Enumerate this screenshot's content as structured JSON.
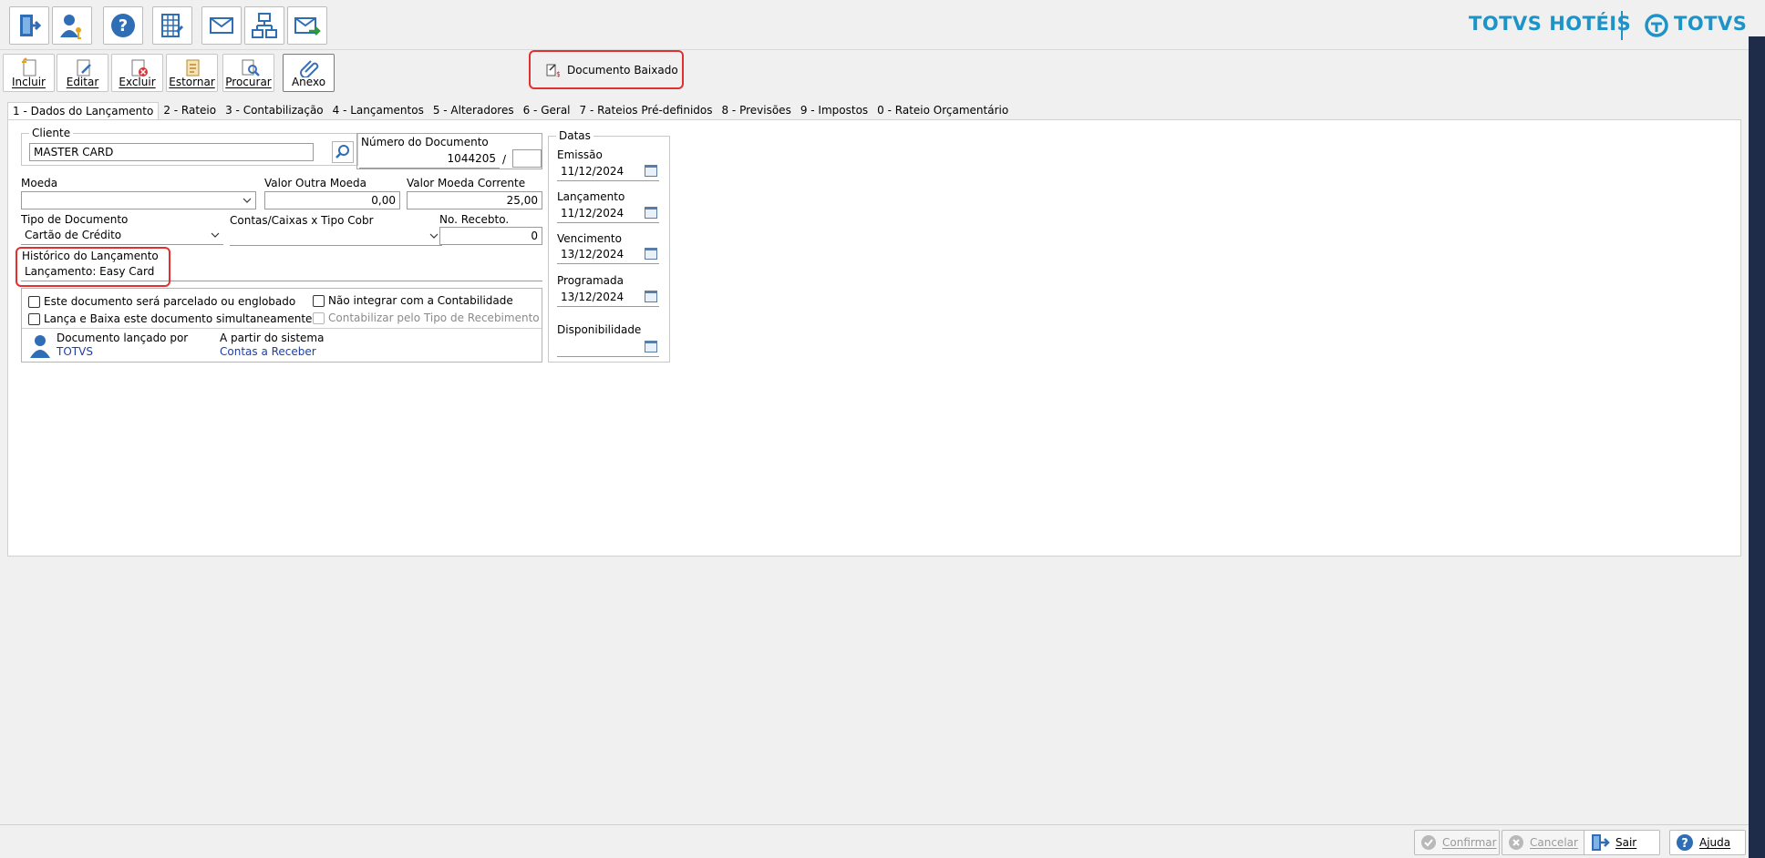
{
  "brand": {
    "product": "TOTVS HOTÉIS",
    "company": "TOTVS",
    "color": "#1e93c8"
  },
  "top_toolbar": [
    {
      "name": "exit-door-icon"
    },
    {
      "name": "user-key-icon"
    },
    {
      "name": "help-icon"
    },
    {
      "name": "calculator-grid-icon"
    },
    {
      "name": "mail-icon"
    },
    {
      "name": "hierarchy-icon"
    },
    {
      "name": "mail-send-icon"
    }
  ],
  "actions": {
    "incluir": "Incluir",
    "editar": "Editar",
    "excluir": "Excluir",
    "estornar": "Estornar",
    "procurar": "Procurar",
    "anexo": "Anexo",
    "documento_baixado": "Documento Baixado"
  },
  "tabs": [
    {
      "label": "1 - Dados do Lançamento",
      "active": true
    },
    {
      "label": "2 - Rateio"
    },
    {
      "label": "3 - Contabilização"
    },
    {
      "label": "4 - Lançamentos"
    },
    {
      "label": "5 - Alteradores"
    },
    {
      "label": "6 - Geral"
    },
    {
      "label": "7 - Rateios Pré-definidos"
    },
    {
      "label": "8 - Previsões"
    },
    {
      "label": "9 - Impostos"
    },
    {
      "label": "0 - Rateio Orçamentário"
    }
  ],
  "form": {
    "cliente_label": "Cliente",
    "cliente_value": "MASTER CARD",
    "numero_label": "Número do Documento",
    "numero_value": "1044205",
    "numero_sep": "/",
    "numero_suffix": "",
    "moeda_label": "Moeda",
    "moeda_value": "",
    "valor_outra_label": "Valor Outra Moeda",
    "valor_outra_value": "0,00",
    "valor_corrente_label": "Valor Moeda Corrente",
    "valor_corrente_value": "25,00",
    "tipo_doc_label": "Tipo de Documento",
    "tipo_doc_value": "Cartão de Crédito",
    "contas_label": "Contas/Caixas x Tipo Cobr",
    "contas_value": "",
    "recebto_label": "No. Recebto.",
    "recebto_value": "0",
    "historico_label": "Histórico do Lançamento",
    "historico_value": "Lançamento: Easy Card",
    "chk_parcelado": "Este documento será parcelado ou englobado",
    "chk_lanca_baixa": "Lança e Baixa este documento simultaneamente",
    "chk_nao_integrar": "Não integrar com a Contabilidade",
    "chk_contabilizar": "Contabilizar pelo Tipo de Recebimento",
    "lancado_por_label": "Documento lançado por",
    "lancado_por_value": "TOTVS",
    "sistema_label": "A partir do sistema",
    "sistema_value": "Contas a Receber"
  },
  "datas": {
    "legend": "Datas",
    "emissao_label": "Emissão",
    "emissao_value": "11/12/2024",
    "lancamento_label": "Lançamento",
    "lancamento_value": "11/12/2024",
    "vencimento_label": "Vencimento",
    "vencimento_value": "13/12/2024",
    "programada_label": "Programada",
    "programada_value": "13/12/2024",
    "disponibilidade_label": "Disponibilidade",
    "disponibilidade_value": ""
  },
  "bottom": {
    "confirmar": "Confirmar",
    "cancelar": "Cancelar",
    "sair": "Sair",
    "ajuda": "Ajuda"
  }
}
